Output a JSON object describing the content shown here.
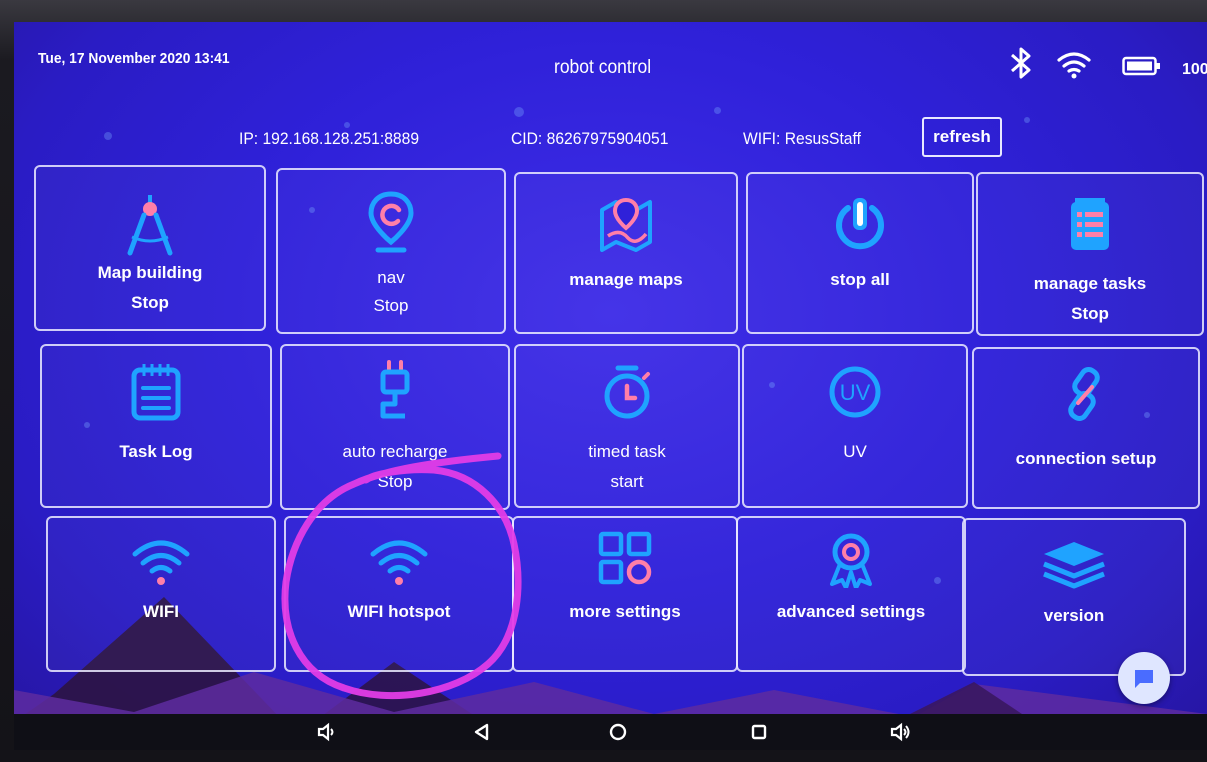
{
  "status_bar": {
    "datetime": "Tue, 17 November 2020 13:41",
    "title": "robot control",
    "battery_text": "100",
    "icons": [
      "bluetooth-icon",
      "wifi-signal-icon",
      "battery-icon"
    ]
  },
  "info": {
    "ip": "IP: 192.168.128.251:8889",
    "cid": "CID: 86267975904051",
    "wifi": "WIFI: ResusStaff",
    "refresh_label": "refresh"
  },
  "tiles": [
    {
      "label": "Map building",
      "sub": "Stop",
      "icon": "compass-tool-icon"
    },
    {
      "label": "nav",
      "sub": "Stop",
      "icon": "location-pin-icon"
    },
    {
      "label": "manage maps",
      "sub": "",
      "icon": "map-icon"
    },
    {
      "label": "stop all",
      "sub": "",
      "icon": "power-icon"
    },
    {
      "label": "manage tasks",
      "sub": "Stop",
      "icon": "task-list-icon"
    },
    {
      "label": "Task Log",
      "sub": "",
      "icon": "notepad-icon"
    },
    {
      "label": "auto recharge",
      "sub": "Stop",
      "icon": "plug-icon"
    },
    {
      "label": "timed task",
      "sub": "start",
      "icon": "timer-icon"
    },
    {
      "label": "UV",
      "sub": "",
      "icon": "uv-icon"
    },
    {
      "label": "connection setup",
      "sub": "",
      "icon": "link-icon"
    },
    {
      "label": "WIFI",
      "sub": "",
      "icon": "wifi-icon"
    },
    {
      "label": "WIFI hotspot",
      "sub": "",
      "icon": "wifi-hotspot-icon"
    },
    {
      "label": "more settings",
      "sub": "",
      "icon": "grid-icon"
    },
    {
      "label": "advanced settings",
      "sub": "",
      "icon": "badge-icon"
    },
    {
      "label": "version",
      "sub": "",
      "icon": "layers-icon"
    }
  ],
  "nav_bar": [
    "volume-down-icon",
    "back-icon",
    "home-icon",
    "recents-icon",
    "volume-up-icon"
  ],
  "colors": {
    "background": "#2f21d9",
    "icon_blue": "#1fa3ff",
    "icon_pink": "#ff7fa8",
    "annotation": "#e23ce6"
  }
}
